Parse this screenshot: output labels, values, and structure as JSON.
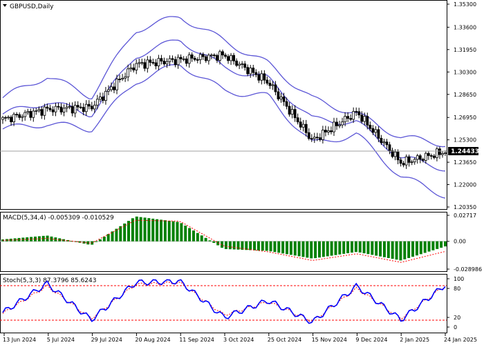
{
  "window": {
    "symbol_title": "GBPUSD,Daily"
  },
  "main_panel": {
    "price_axis_labels": [
      "1.35300",
      "1.33600",
      "1.31950",
      "1.30300",
      "1.28650",
      "1.26950",
      "1.25300",
      "1.23650",
      "1.22000",
      "1.20350"
    ],
    "current_price_label": "1.24433",
    "current_price": 1.24433,
    "y_range": [
      1.2035,
      1.353
    ]
  },
  "macd_panel": {
    "title": "MACD(5,34,4) -0.005309 -0.010529",
    "axis_labels": [
      "0.02717",
      "0.00",
      "-0.028986"
    ]
  },
  "stoch_panel": {
    "title": "Stoch(5,3,3) 87.3796 85.6243",
    "axis_labels": [
      "100",
      "80",
      "20",
      "0"
    ]
  },
  "time_axis_labels": [
    "13 Jun 2024",
    "5 Jul 2024",
    "29 Jul 2024",
    "20 Aug 2024",
    "11 Sep 2024",
    "3 Oct 2024",
    "25 Oct 2024",
    "15 Nov 2024",
    "9 Dec 2024",
    "2 Jan 2025",
    "24 Jan 2025"
  ],
  "colors": {
    "bands": "#5b55d6",
    "candle": "#000000",
    "macd_hist": "#008000",
    "macd_signal": "#ff0000",
    "stoch_main": "#0000ff",
    "stoch_signal": "#ff0000",
    "level_lines": "#ff0000"
  },
  "chart_data": [
    {
      "type": "candlestick",
      "title": "GBPUSD,Daily",
      "overlay": "Bollinger Bands",
      "x": [
        "13 Jun 2024",
        "5 Jul 2024",
        "29 Jul 2024",
        "20 Aug 2024",
        "11 Sep 2024",
        "3 Oct 2024",
        "25 Oct 2024",
        "15 Nov 2024",
        "9 Dec 2024",
        "2 Jan 2025",
        "24 Jan 2025"
      ],
      "close": [
        1.268,
        1.2755,
        1.277,
        1.3085,
        1.312,
        1.3155,
        1.2955,
        1.2525,
        1.2735,
        1.236,
        1.2443
      ],
      "upper_band": [
        1.284,
        1.3,
        1.285,
        1.334,
        1.344,
        1.326,
        1.309,
        1.283,
        1.272,
        1.255,
        1.25
      ],
      "middle_band": [
        1.272,
        1.281,
        1.272,
        1.315,
        1.327,
        1.306,
        1.298,
        1.268,
        1.266,
        1.24,
        1.232
      ],
      "lower_band": [
        1.261,
        1.265,
        1.261,
        1.296,
        1.309,
        1.289,
        1.285,
        1.25,
        1.257,
        1.226,
        1.212
      ],
      "ylim": [
        1.2035,
        1.353
      ]
    },
    {
      "type": "bar",
      "title": "MACD(5,34,4) -0.005309 -0.010529",
      "x": [
        "13 Jun 2024",
        "5 Jul 2024",
        "29 Jul 2024",
        "20 Aug 2024",
        "11 Sep 2024",
        "3 Oct 2024",
        "25 Oct 2024",
        "15 Nov 2024",
        "9 Dec 2024",
        "2 Jan 2025",
        "24 Jan 2025"
      ],
      "series": [
        {
          "name": "MACD",
          "values": [
            0.002,
            0.006,
            -0.004,
            0.026,
            0.02,
            -0.008,
            -0.01,
            -0.018,
            -0.011,
            -0.02,
            -0.005309
          ]
        },
        {
          "name": "Signal",
          "values": [
            0.001,
            0.003,
            -0.002,
            0.022,
            0.021,
            -0.005,
            -0.011,
            -0.02,
            -0.013,
            -0.022,
            -0.010529
          ]
        }
      ],
      "ylim": [
        -0.028986,
        0.02717
      ]
    },
    {
      "type": "line",
      "title": "Stoch(5,3,3) 87.3796 85.6243",
      "x": [
        "13 Jun 2024",
        "5 Jul 2024",
        "29 Jul 2024",
        "20 Aug 2024",
        "11 Sep 2024",
        "3 Oct 2024",
        "25 Oct 2024",
        "15 Nov 2024",
        "9 Dec 2024",
        "2 Jan 2025",
        "24 Jan 2025"
      ],
      "series": [
        {
          "name": "%K",
          "values": [
            30,
            90,
            15,
            92,
            95,
            20,
            55,
            10,
            85,
            15,
            87.3796
          ]
        },
        {
          "name": "%D",
          "values": [
            28,
            85,
            18,
            88,
            92,
            25,
            52,
            12,
            80,
            18,
            85.6243
          ]
        }
      ],
      "levels": [
        80,
        20
      ],
      "ylim": [
        0,
        100
      ]
    }
  ]
}
